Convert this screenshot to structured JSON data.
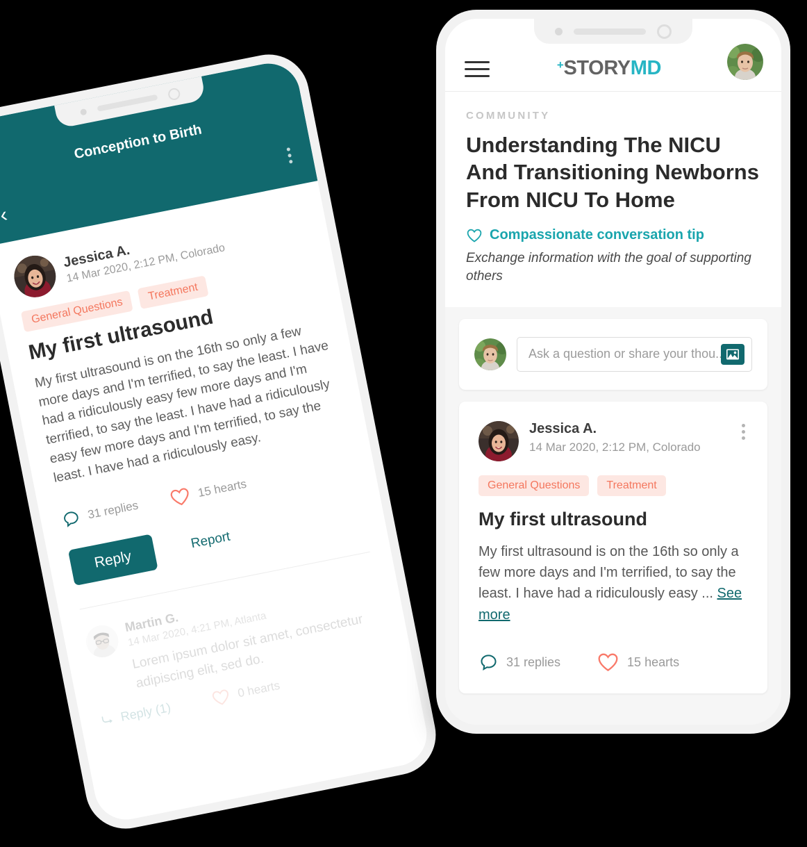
{
  "left_phone": {
    "header": {
      "title": "Conception to Birth",
      "back_icon": "chevron-left-icon",
      "menu_icon": "kebab-menu-icon"
    },
    "post": {
      "author": "Jessica A.",
      "meta": "14 Mar 2020, 2:12 PM, Colorado",
      "tags": [
        "General Questions",
        "Treatment"
      ],
      "title": "My first ultrasound",
      "body": "My first ultrasound is on the 16th so only a few more days and I'm terrified, to say the least. I have had a ridiculously easy few more days and I'm terrified, to say the least. I have had a ridiculously easy few more days and I'm terrified, to say the least. I have had a ridiculously easy.",
      "replies_label": "31 replies",
      "hearts_label": "15 hearts",
      "reply_button": "Reply",
      "report_link": "Report"
    },
    "comment": {
      "author": "Martin G.",
      "meta": "14 Mar 2020, 4:21 PM, Atlanta",
      "body": "Lorem ipsum dolor sit amet, consectetur adipiscing elit, sed do.",
      "reply_label": "Reply (1)",
      "hearts_label": "0 hearts"
    }
  },
  "right_phone": {
    "header": {
      "menu_icon": "hamburger-menu-icon",
      "logo_plus": "+",
      "logo_primary": "STORY",
      "logo_secondary": "MD",
      "avatar_name": "user-avatar"
    },
    "eyebrow": "COMMUNITY",
    "title": "Understanding The NICU And Transitioning Newborns From NICU To Home",
    "tip_icon": "heart-outline-icon",
    "tip_label": "Compassionate conversation tip",
    "tip_subtitle": "Exchange information with the goal of supporting others",
    "compose": {
      "placeholder": "Ask a question or share your thou..",
      "value": "",
      "image_icon": "image-upload-icon"
    },
    "post": {
      "author": "Jessica A.",
      "meta": "14 Mar 2020, 2:12 PM, Colorado",
      "menu_icon": "kebab-menu-icon",
      "tags": [
        "General Questions",
        "Treatment"
      ],
      "title": "My first ultrasound",
      "body_truncated": "My first ultrasound is on the 16th so only a few more days and I'm terrified, to say the least. I have had a ridiculously easy ... ",
      "see_more": "See more",
      "replies_label": "31 replies",
      "hearts_label": "15 hearts"
    }
  },
  "colors": {
    "teal": "#11696e",
    "cyan": "#27b5c4",
    "coral": "#f4775e",
    "tag_bg": "#fde7e2",
    "tip_teal": "#1aa5ad",
    "background": "#000000"
  }
}
